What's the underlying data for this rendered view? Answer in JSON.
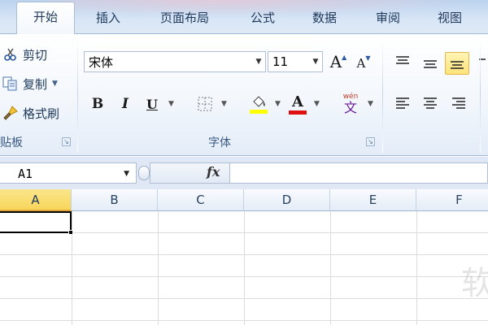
{
  "ribbon_tabs": [
    {
      "label": "开始",
      "active": true
    },
    {
      "label": "插入"
    },
    {
      "label": "页面布局"
    },
    {
      "label": "公式"
    },
    {
      "label": "数据"
    },
    {
      "label": "审阅"
    },
    {
      "label": "视图"
    }
  ],
  "clipboard": {
    "cut": "剪切",
    "copy": "复制",
    "format_painter": "格式刷",
    "group_label": "贴板"
  },
  "font": {
    "name": "宋体",
    "size": "11",
    "group_label": "字体",
    "bold": "B",
    "italic": "I",
    "underline": "U",
    "grow": "A",
    "shrink": "A",
    "font_color_glyph": "A",
    "phonetic_top": "wén",
    "phonetic_bottom": "文",
    "fill_color": "#ffff00",
    "font_color": "#e01010"
  },
  "alignment": {
    "active_button": "align-bottom"
  },
  "formula_bar": {
    "name_box": "A1",
    "fx": "fx",
    "value": ""
  },
  "sheet": {
    "columns": [
      "A",
      "B",
      "C",
      "D",
      "E",
      "F"
    ],
    "selected_column": "A",
    "active_cell": "A1",
    "watermark": "软"
  },
  "colors": {
    "ribbon_tab_bg": "#d8e6f6",
    "selected_header": "#f7d65a",
    "grid_line": "#dadcdd"
  }
}
